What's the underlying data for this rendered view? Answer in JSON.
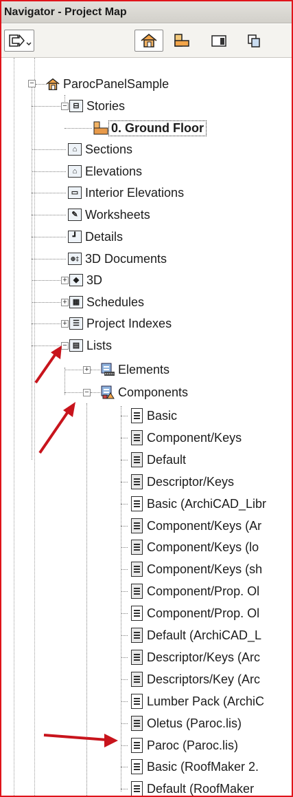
{
  "window": {
    "title": "Navigator - Project Map"
  },
  "toolbar": {
    "buttons": [
      {
        "name": "publish-set-button",
        "icon": "publish-set-icon"
      },
      {
        "name": "project-map-button",
        "icon": "house-icon",
        "pressed": true
      },
      {
        "name": "view-map-button",
        "icon": "folder-view-icon"
      },
      {
        "name": "layout-book-button",
        "icon": "layout-icon"
      },
      {
        "name": "publisher-sets-button",
        "icon": "publisher-icon"
      }
    ]
  },
  "tree": {
    "root": "ParocPanelSample",
    "stories": "Stories",
    "ground_floor": "0. Ground Floor",
    "sections": "Sections",
    "elevations": "Elevations",
    "interior_elevations": "Interior Elevations",
    "worksheets": "Worksheets",
    "details": "Details",
    "documents_3d": "3D Documents",
    "node_3d": "3D",
    "schedules": "Schedules",
    "project_indexes": "Project Indexes",
    "lists": "Lists",
    "elements": "Elements",
    "components": "Components",
    "component_items": [
      {
        "label": "Basic",
        "style": "plain"
      },
      {
        "label": "Component/Keys",
        "style": "grid"
      },
      {
        "label": "Default",
        "style": "grid"
      },
      {
        "label": "Descriptor/Keys",
        "style": "grid"
      },
      {
        "label": "Basic (ArchiCAD_Libr",
        "style": "plain"
      },
      {
        "label": "Component/Keys (Ar",
        "style": "grid"
      },
      {
        "label": "Component/Keys (lo",
        "style": "grid"
      },
      {
        "label": "Component/Keys (sh",
        "style": "grid"
      },
      {
        "label": "Component/Prop. Ol",
        "style": "grid"
      },
      {
        "label": "Component/Prop. Ol",
        "style": "plain"
      },
      {
        "label": "Default (ArchiCAD_L",
        "style": "grid"
      },
      {
        "label": "Descriptor/Keys (Arc",
        "style": "grid"
      },
      {
        "label": "Descriptors/Key (Arc",
        "style": "grid"
      },
      {
        "label": "Lumber Pack (ArchiC",
        "style": "plain"
      },
      {
        "label": "Oletus (Paroc.lis)",
        "style": "grid"
      },
      {
        "label": "Paroc (Paroc.lis)",
        "style": "plain"
      },
      {
        "label": "Basic (RoofMaker 2.",
        "style": "plain"
      },
      {
        "label": "Default (RoofMaker",
        "style": "plain"
      }
    ]
  },
  "colors": {
    "frame": "#e0141b",
    "arrow": "#c8141c",
    "story_orange": "#e89a4a"
  }
}
